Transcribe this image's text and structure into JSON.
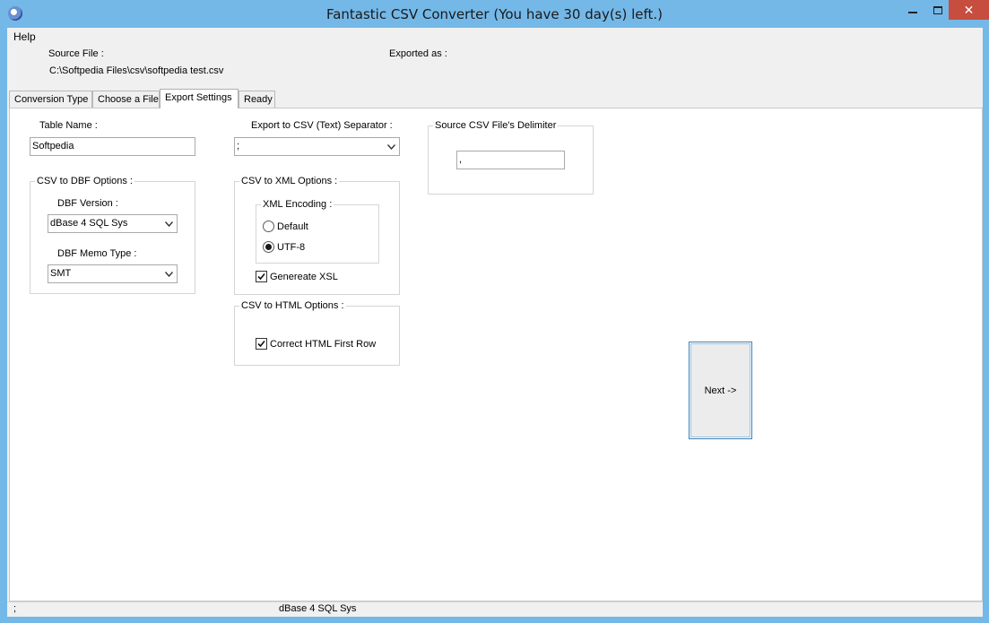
{
  "window": {
    "title": "Fantastic CSV Converter  (You have 30 day(s) left.)",
    "controls": {
      "minimize": "─",
      "maximize": "□",
      "close": "✕"
    }
  },
  "menu": {
    "help": "Help"
  },
  "info": {
    "source_file_label": "Source File :",
    "source_file_path": "C:\\Softpedia Files\\csv\\softpedia test.csv",
    "exported_as_label": "Exported as :"
  },
  "tabs": [
    "Conversion Type",
    "Choose a File",
    "Export Settings",
    "Ready"
  ],
  "active_tab": "Export Settings",
  "export_settings": {
    "table_name_label": "Table Name :",
    "table_name_value": "Softpedia",
    "dbf_group": "CSV to DBF Options :",
    "dbf_version_label": "DBF Version :",
    "dbf_version_value": "dBase 4 SQL Sys",
    "dbf_memo_label": "DBF Memo Type :",
    "dbf_memo_value": "SMT",
    "separator_label": "Export to CSV (Text) Separator :",
    "separator_value": ";",
    "xml_group": "CSV to XML Options :",
    "xml_encoding_group": "XML Encoding :",
    "radio_default": "Default",
    "radio_utf8": "UTF-8",
    "generate_xsl": "Genereate XSL",
    "html_group": "CSV to HTML Options :",
    "correct_html": "Correct HTML First Row",
    "delimiter_group": "Source CSV File's Delimiter",
    "delimiter_value": ","
  },
  "next_button": "Next ->",
  "status": {
    "left": ";",
    "middle": "dBase 4 SQL Sys"
  }
}
